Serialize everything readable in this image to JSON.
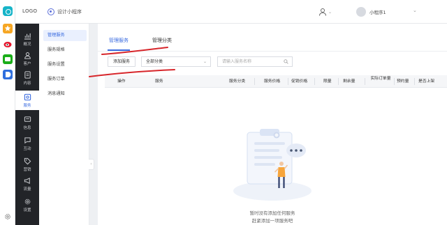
{
  "header": {
    "logo_text": "LOGO",
    "app_name": "设计小程序",
    "account_name": "小程序1"
  },
  "sidebar": {
    "items": [
      {
        "label": "概况",
        "icon": "chart-icon"
      },
      {
        "label": "客户",
        "icon": "user-icon"
      },
      {
        "label": "内容",
        "icon": "document-icon"
      },
      {
        "label": "服务",
        "icon": "service-icon",
        "active": true
      },
      {
        "label": "信息",
        "icon": "message-icon"
      },
      {
        "label": "互动",
        "icon": "chat-icon"
      },
      {
        "label": "营销",
        "icon": "tag-icon"
      },
      {
        "label": "流量",
        "icon": "megaphone-icon"
      },
      {
        "label": "设置",
        "icon": "gear-icon"
      }
    ]
  },
  "subnav": {
    "items": [
      {
        "label": "管理服务",
        "active": true
      },
      {
        "label": "服务规格"
      },
      {
        "label": "服务设置"
      },
      {
        "label": "服务订单"
      },
      {
        "label": "消息通知"
      }
    ]
  },
  "main": {
    "tabs": [
      {
        "label": "管理服务",
        "active": true
      },
      {
        "label": "管理分类"
      }
    ],
    "toolbar": {
      "add_label": "添加服务",
      "category_selected": "全部分类",
      "search_placeholder": "请输入服务名称"
    },
    "table_headers": [
      "操作",
      "服务",
      "服务分类",
      "服务价格",
      "促销价格",
      "限量",
      "剩余量",
      "实际订单量",
      "预约量",
      "是否上架"
    ],
    "empty": {
      "line1": "暂时没有添加任何服务",
      "line2": "赶紧添加一项服务吧"
    }
  },
  "colors": {
    "accent": "#3a6be0",
    "sidebar_bg": "#222428",
    "annotation_red": "#d7262b"
  }
}
